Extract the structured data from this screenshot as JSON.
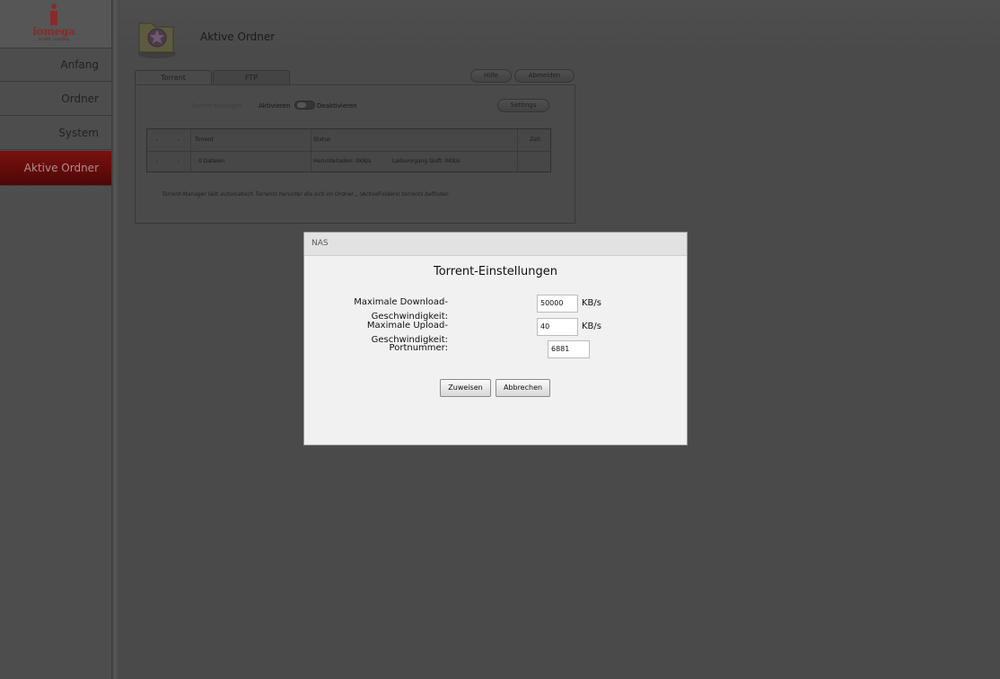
{
  "logo": {
    "brand": "iomega",
    "tagline": "an EMC company"
  },
  "sidebar": {
    "items": [
      {
        "label": "Anfang"
      },
      {
        "label": "Ordner"
      },
      {
        "label": "System"
      },
      {
        "label": "Aktive Ordner",
        "active": true
      }
    ]
  },
  "header": {
    "title": "Aktive Ordner",
    "icon": "folder-icon"
  },
  "tabs": [
    {
      "label": "Torrent",
      "active": true
    },
    {
      "label": "FTP"
    }
  ],
  "top_buttons": {
    "help": "Hilfe",
    "logout": "Abmelden"
  },
  "torrent_manager": {
    "label": "Torrent-Manager",
    "enable": "Aktivieren",
    "disable": "Deaktivieren",
    "settings_button": "Settings"
  },
  "table": {
    "headers": [
      "-",
      "-",
      "Torrent",
      "Status",
      "Zeit"
    ],
    "row": {
      "c1": "-",
      "c2": "-",
      "torrent": "0 Dateien",
      "status_download": "Herunterladen: 0KB/s",
      "status_upload": "Ladevorgang läuft: 0KB/s",
      "time": ""
    }
  },
  "note": "Torrent-Manager lädt automatisch Torrents herunter die sich im Ordner „ \\ActiveFolders\\ torrents befinden.",
  "dialog": {
    "window_title": "NAS",
    "heading": "Torrent-Einstellungen",
    "download_label_1": "Maximale Download-",
    "download_label_2": "Geschwindigkeit:",
    "download_value": "50000",
    "download_unit": "KB/s",
    "upload_label_1": "Maximale Upload-",
    "upload_label_2": "Geschwindigkeit:",
    "upload_value": "40",
    "upload_unit": "KB/s",
    "port_label": "Portnummer:",
    "port_value": "6881",
    "apply_button": "Zuweisen",
    "cancel_button": "Abbrechen"
  },
  "colors": {
    "accent": "#7a1010",
    "overlay": "#4a4a4a",
    "dialog_bg": "#f1f1f1"
  }
}
